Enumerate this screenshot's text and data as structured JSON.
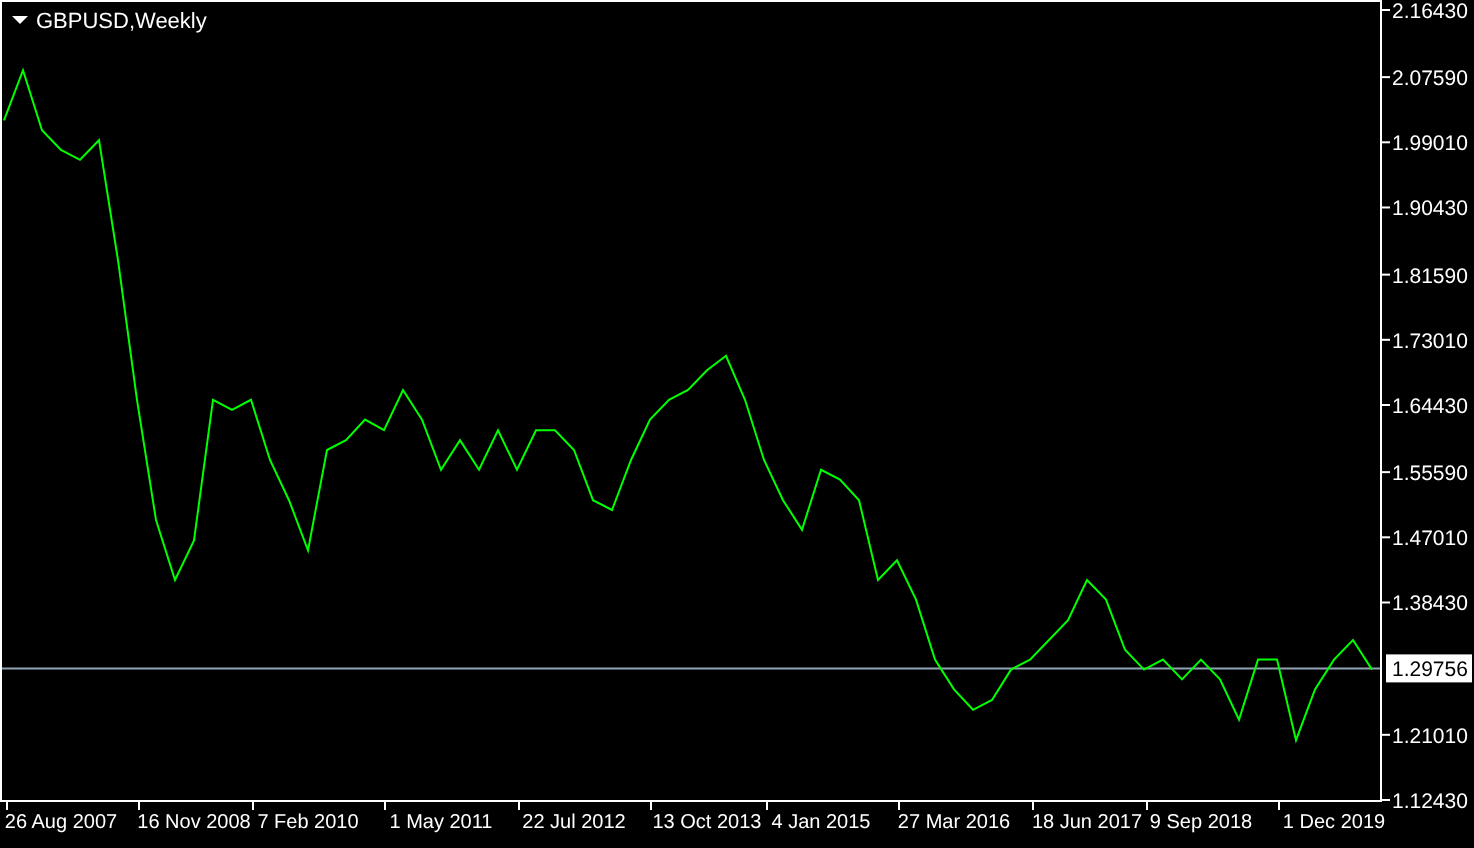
{
  "chart": {
    "title": "GBPUSD,Weekly",
    "chart_data": {
      "type": "line",
      "ylim": [
        1.1243,
        2.1748
      ],
      "ref_lines": [
        {
          "axis": "y",
          "value": 1.29756,
          "label": "1.29756",
          "color": "#8fa3b5"
        }
      ],
      "yticks": [
        {
          "value": 2.1643,
          "label": "2.16430"
        },
        {
          "value": 2.0759,
          "label": "2.07590"
        },
        {
          "value": 1.9901,
          "label": "1.99010"
        },
        {
          "value": 1.9043,
          "label": "1.90430"
        },
        {
          "value": 1.8159,
          "label": "1.81590"
        },
        {
          "value": 1.7301,
          "label": "1.73010"
        },
        {
          "value": 1.6443,
          "label": "1.64430"
        },
        {
          "value": 1.5559,
          "label": "1.55590"
        },
        {
          "value": 1.4701,
          "label": "1.47010"
        },
        {
          "value": 1.3843,
          "label": "1.38430"
        },
        {
          "value": 1.2101,
          "label": "1.21010"
        },
        {
          "value": 1.1243,
          "label": "1.12430"
        }
      ],
      "categories": [
        null,
        null,
        null,
        "26 Aug 2007",
        null,
        null,
        null,
        null,
        null,
        null,
        "16 Nov 2008",
        null,
        null,
        null,
        null,
        null,
        "7 Feb 2010",
        null,
        null,
        null,
        null,
        null,
        null,
        "1 May 2011",
        null,
        null,
        null,
        null,
        null,
        null,
        "22 Jul 2012",
        null,
        null,
        null,
        null,
        null,
        null,
        "13 Oct 2013",
        null,
        null,
        null,
        null,
        null,
        "4 Jan 2015",
        null,
        null,
        null,
        null,
        null,
        null,
        "27 Mar 2016",
        null,
        null,
        null,
        null,
        null,
        null,
        "18 Jun 2017",
        null,
        null,
        null,
        null,
        null,
        "9 Sep 2018",
        null,
        null,
        null,
        null,
        null,
        null,
        "1 Dec 2019",
        null,
        null
      ],
      "series": [
        {
          "color": "#00ff00",
          "values": [
            2.019,
            2.085,
            2.006,
            1.98,
            1.967,
            1.993,
            1.835,
            1.651,
            1.493,
            1.414,
            1.466,
            1.651,
            1.638,
            1.651,
            1.572,
            1.519,
            1.453,
            1.585,
            1.598,
            1.625,
            1.611,
            1.664,
            1.625,
            1.559,
            1.598,
            1.559,
            1.611,
            1.559,
            1.611,
            1.611,
            1.585,
            1.519,
            1.506,
            1.572,
            1.625,
            1.651,
            1.664,
            1.69,
            1.709,
            1.651,
            1.572,
            1.519,
            1.48,
            1.559,
            1.546,
            1.519,
            1.414,
            1.44,
            1.388,
            1.309,
            1.27,
            1.243,
            1.256,
            1.296,
            1.309,
            1.335,
            1.361,
            1.414,
            1.388,
            1.322,
            1.296,
            1.309,
            1.283,
            1.309,
            1.283,
            1.23,
            1.309,
            1.309,
            1.203,
            1.27,
            1.309,
            1.335,
            1.296
          ]
        }
      ]
    }
  }
}
